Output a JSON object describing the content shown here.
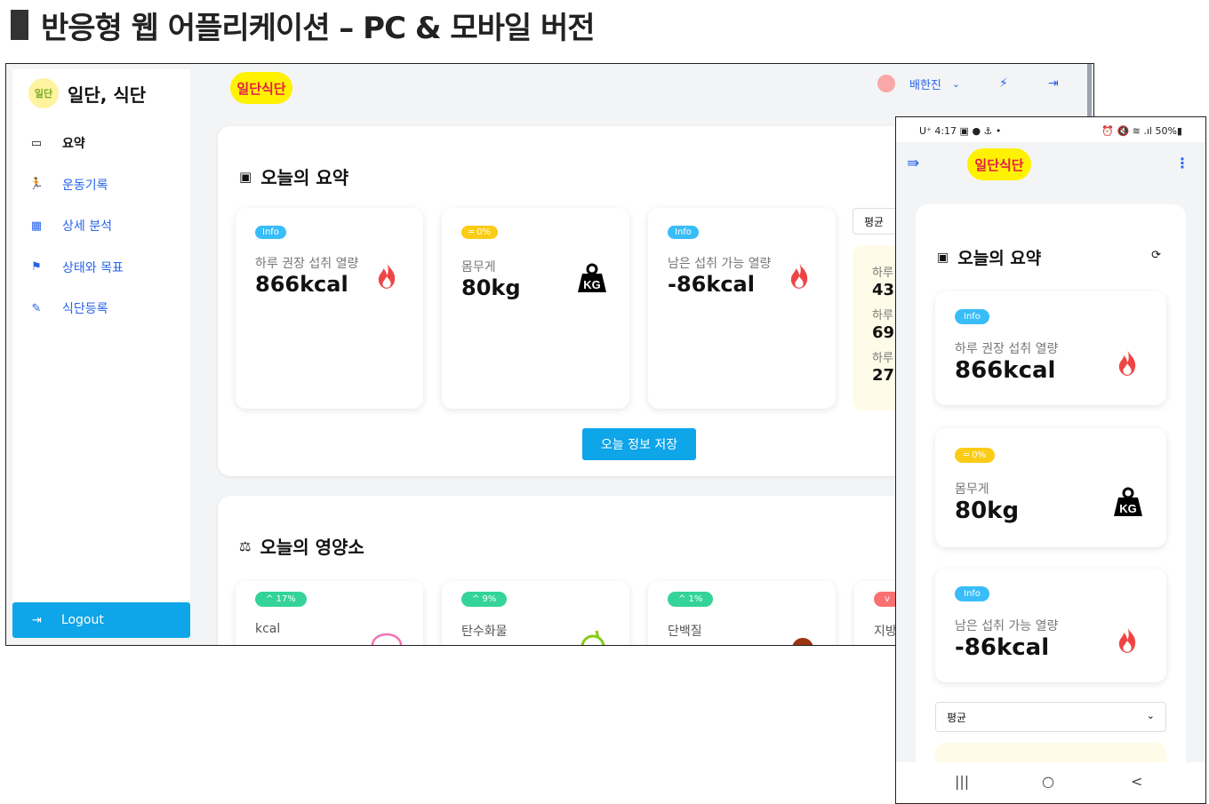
{
  "page_heading": "반응형 웹 어플리케이션 – PC & 모바일 버전",
  "desktop": {
    "brand": {
      "logo_text": "일단\n식단",
      "name": "일단, 식단"
    },
    "nav": [
      {
        "label": "요약",
        "icon": "monitor-icon",
        "active": true
      },
      {
        "label": "운동기록",
        "icon": "running-icon",
        "active": false
      },
      {
        "label": "상세 분석",
        "icon": "calendar-icon",
        "active": false
      },
      {
        "label": "상태와 목표",
        "icon": "flag-icon",
        "active": false
      },
      {
        "label": "식단등록",
        "icon": "edit-icon",
        "active": false
      }
    ],
    "logout_label": "Logout",
    "topbar": {
      "logo_text": "일단식단",
      "user_name": "배한진"
    },
    "summary": {
      "title": "오늘의 요약",
      "cards": [
        {
          "badge": "Info",
          "label": "하루 권장 섭취 열량",
          "value": "866kcal",
          "icon": "fire-icon"
        },
        {
          "badge": "═ 0%",
          "label": "몸무게",
          "value": "80kg",
          "icon": "kg-weight-icon"
        },
        {
          "badge": "Info",
          "label": "남은 섭취 가능 열량",
          "value": "-86kcal",
          "icon": "fire-icon"
        }
      ],
      "avg_select": "평균",
      "avg_rows": [
        {
          "label": "하루",
          "value": "43"
        },
        {
          "label": "하루",
          "value": "69"
        },
        {
          "label": "하루",
          "value": "27"
        }
      ],
      "save_button": "오늘 정보 저장"
    },
    "nutrition": {
      "title": "오늘의 영양소",
      "cards": [
        {
          "badge": "^ 17%",
          "label": "kcal"
        },
        {
          "badge": "^ 9%",
          "label": "탄수화물"
        },
        {
          "badge": "^ 1%",
          "label": "단백질"
        },
        {
          "badge": "v",
          "label": "지방"
        }
      ]
    },
    "colors": {
      "accent": "#0ea5e9",
      "link": "#2563eb",
      "info": "#38bdf8",
      "warn": "#facc15",
      "success": "#34d399",
      "danger": "#f87171"
    }
  },
  "mobile": {
    "status_left": "U⁺ 4:17 ▣ ● ⚓ •",
    "status_right": "⏰ 🔇 ≋ .ıl 50%▮",
    "logo_text": "일단식단",
    "summary_title": "오늘의 요약",
    "cards": [
      {
        "badge": "Info",
        "label": "하루 권장 섭취 열량",
        "value": "866kcal"
      },
      {
        "badge": "═ 0%",
        "label": "몸무게",
        "value": "80kg"
      },
      {
        "badge": "Info",
        "label": "남은 섭취 가능 열량",
        "value": "-86kcal"
      }
    ],
    "avg_select": "평균",
    "nav_buttons": [
      "|||",
      "○",
      "<"
    ]
  }
}
